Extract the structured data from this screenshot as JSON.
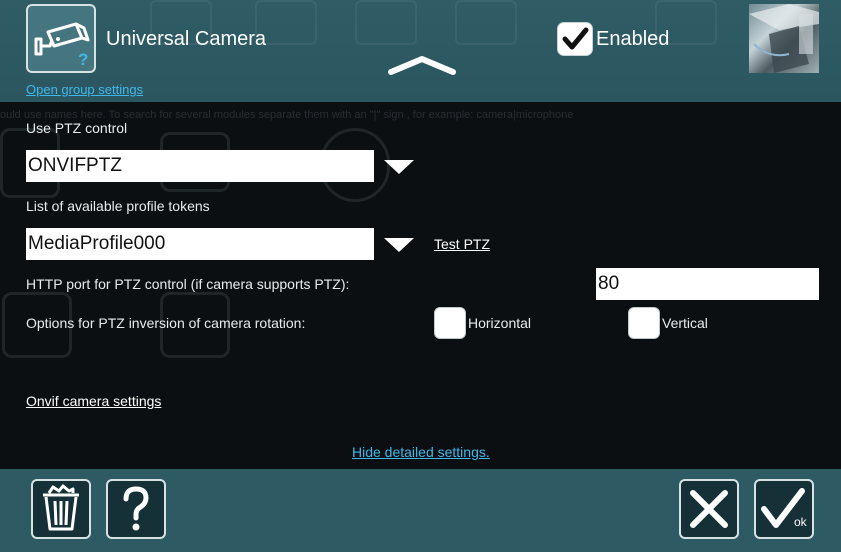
{
  "header": {
    "title": "Universal Camera",
    "camera_icon": "cctv-camera-icon",
    "help_mark": "?",
    "enabled_label": "Enabled",
    "enabled_checked": true,
    "group_settings_link": "Open group settings"
  },
  "background_hint": "ould use names here. To search for several modules separate them with an \"|\" sign , for example: camera|microphone",
  "ptz": {
    "use_label": "Use PTZ control",
    "use_value": "ONVIFPTZ",
    "profiles_label": "List of available profile tokens",
    "profile_value": "MediaProfile000",
    "test_link": "Test PTZ",
    "http_port_label": "HTTP port for PTZ control (if camera supports PTZ):",
    "http_port_value": "80",
    "inversion_label": "Options for PTZ inversion of camera rotation:",
    "horizontal_label": "Horizontal",
    "horizontal_checked": false,
    "vertical_label": "Vertical",
    "vertical_checked": false
  },
  "onvif_link": "Onvif camera settings",
  "hide_detailed_link": "Hide detailed settings.",
  "footer": {
    "delete_icon": "trash-icon",
    "help_icon": "question-icon",
    "cancel_icon": "close-icon",
    "ok_icon": "checkmark-icon",
    "ok_label": "ok"
  },
  "colors": {
    "header_bg": "#2f5c65",
    "body_bg": "#0c0f12",
    "link_blue": "#40b8ea",
    "footer_bg": "#2e5a63"
  }
}
